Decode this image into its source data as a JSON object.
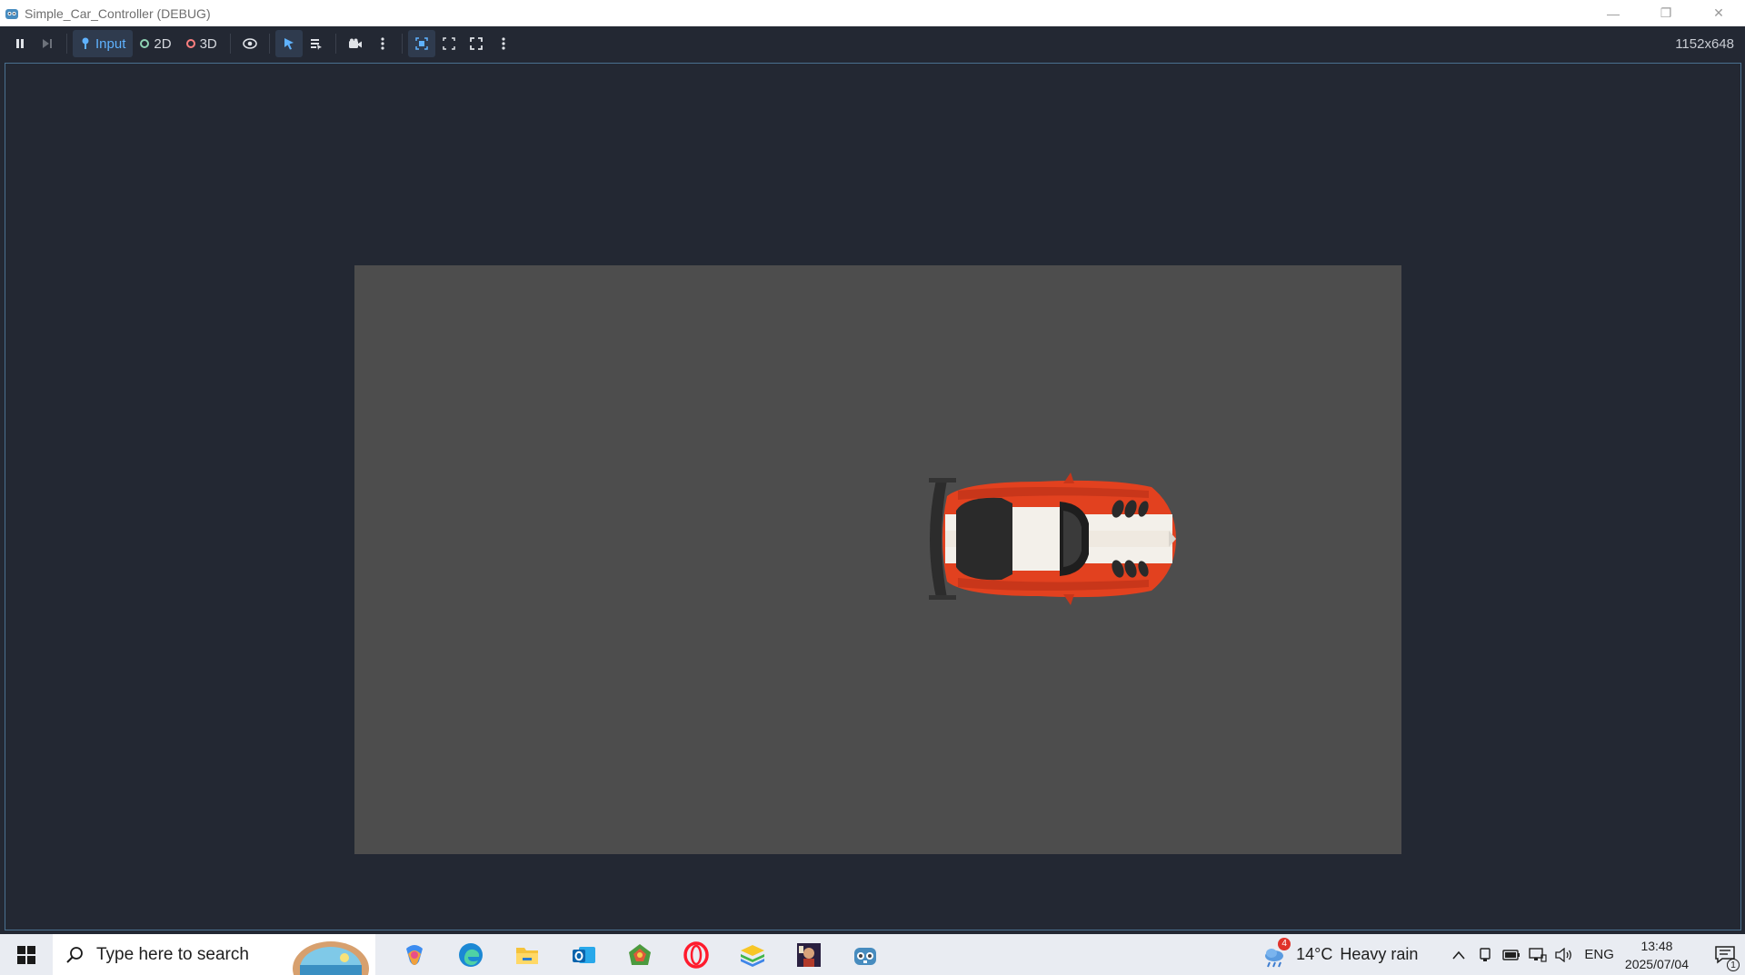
{
  "window": {
    "title": "Simple_Car_Controller (DEBUG)",
    "controls": {
      "minimize": "—",
      "maximize": "❐",
      "close": "✕"
    }
  },
  "toolbar": {
    "input_label": "Input",
    "mode_2d_label": "2D",
    "mode_3d_label": "3D",
    "resolution": "1152x648",
    "colors": {
      "accent": "#5fb2ff",
      "dot_2d": "#8fd3b4",
      "dot_3d": "#fc7f7f"
    }
  },
  "game": {
    "background": "#4d4d4d",
    "car_color": "#e2411f",
    "stripe_color": "#f3f0ea"
  },
  "taskbar": {
    "search_placeholder": "Type here to search",
    "weather_temp": "14°C",
    "weather_desc": "Heavy rain",
    "weather_badge": "4",
    "language": "ENG",
    "time": "13:48",
    "date": "2025/07/04",
    "notification_count": "1",
    "apps": [
      "copilot-icon",
      "edge-icon",
      "file-explorer-icon",
      "outlook-icon",
      "game-app-icon",
      "opera-icon",
      "bluestacks-icon",
      "game-app-2-icon",
      "godot-icon"
    ]
  }
}
